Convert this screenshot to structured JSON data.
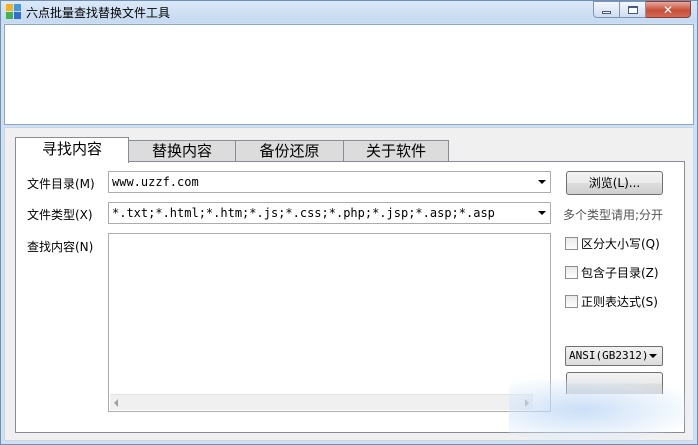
{
  "window": {
    "title": "六点批量查找替换文件工具",
    "close_glyph": "✕"
  },
  "tabs": [
    {
      "label": "寻找内容",
      "active": true
    },
    {
      "label": "替换内容",
      "active": false
    },
    {
      "label": "备份还原",
      "active": false
    },
    {
      "label": "关于软件",
      "active": false
    }
  ],
  "form": {
    "dir_label": "文件目录(M)",
    "dir_value": "www.uzzf.com",
    "type_label": "文件类型(X)",
    "type_value": "*.txt;*.html;*.htm;*.js;*.css;*.php;*.jsp;*.asp;*.asp",
    "find_label": "查找内容(N)",
    "find_value": ""
  },
  "side": {
    "browse_label": "浏览(L)...",
    "type_hint": "多个类型请用;分开",
    "checkboxes": [
      {
        "label": "区分大小写(Q)",
        "checked": false
      },
      {
        "label": "包含子目录(Z)",
        "checked": false
      },
      {
        "label": "正则表达式(S)",
        "checked": false
      }
    ],
    "encoding_value": "ANSI(GB2312)"
  }
}
